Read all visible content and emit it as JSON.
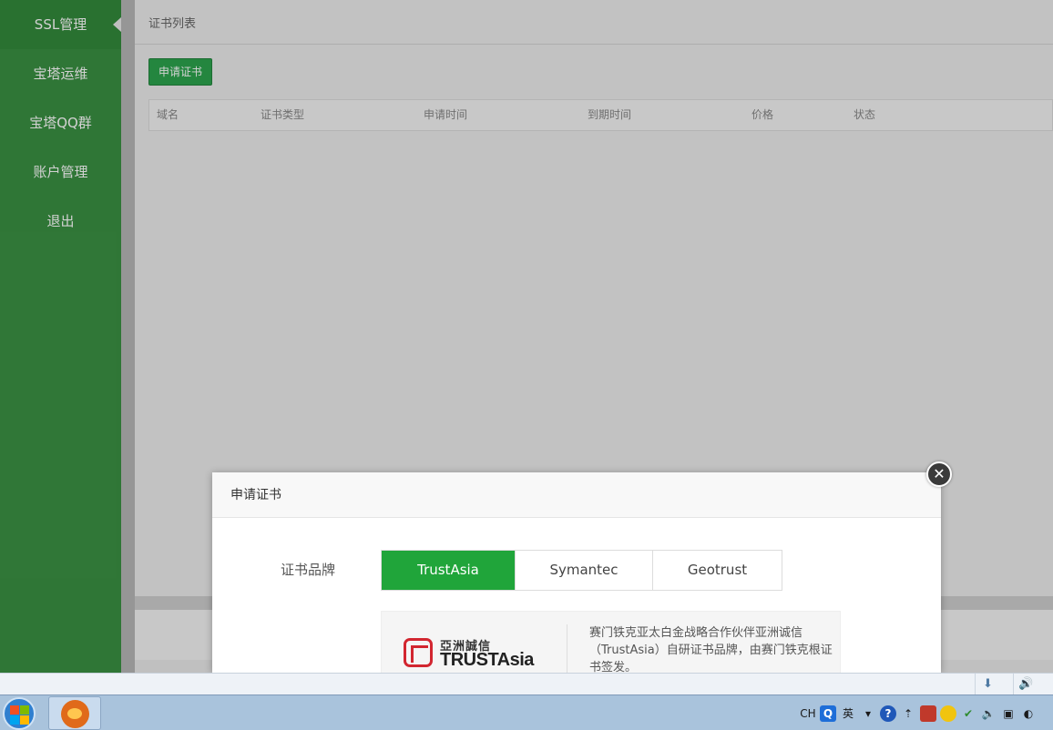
{
  "sidebar": {
    "items": [
      {
        "label": "SSL管理",
        "active": true
      },
      {
        "label": "宝塔运维"
      },
      {
        "label": "宝塔QQ群"
      },
      {
        "label": "账户管理"
      },
      {
        "label": "退出"
      }
    ]
  },
  "main": {
    "title": "证书列表",
    "apply_button": "申请证书",
    "table_headers": [
      "域名",
      "证书类型",
      "申请时间",
      "到期时间",
      "价格",
      "状态"
    ]
  },
  "modal": {
    "title": "申请证书",
    "brand_label": "证书品牌",
    "brands": [
      {
        "label": "TrustAsia",
        "active": true
      },
      {
        "label": "Symantec"
      },
      {
        "label": "Geotrust"
      }
    ],
    "logo_cn": "亞洲誠信",
    "logo_en": "TRUSTAsia",
    "description": "赛门铁克亚太白金战略合作伙伴亚洲诚信（TrustAsia）自研证书品牌，由赛门铁克根证书签发。"
  },
  "taskbar": {
    "tray_lang": "CH",
    "tray_q": "Q",
    "tray_ime": "英",
    "tray_help": "?"
  },
  "colors": {
    "sidebar": "#3a9143",
    "primary_green": "#20a53a",
    "button_green": "#2da44e",
    "logo_red": "#d22630"
  }
}
